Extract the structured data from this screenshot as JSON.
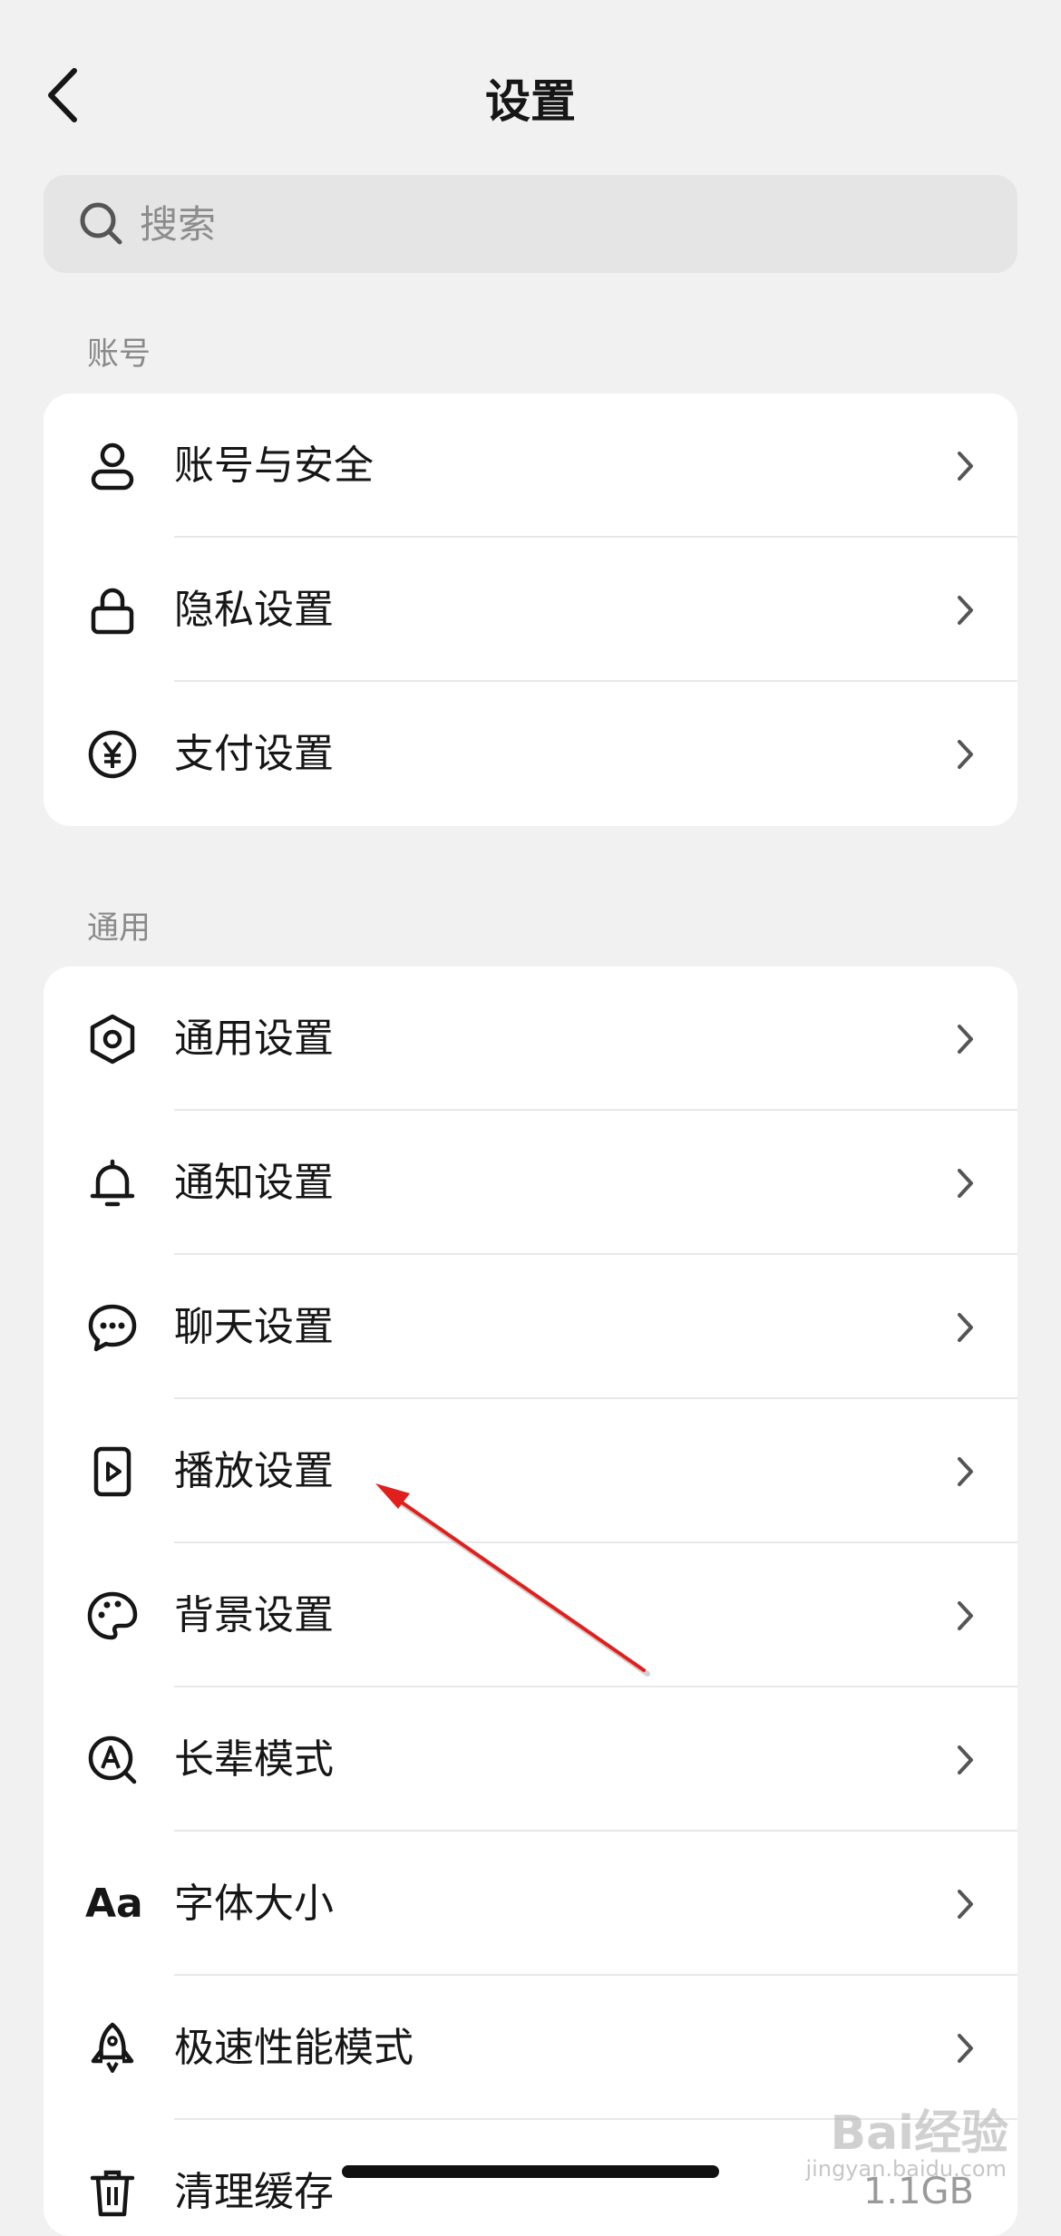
{
  "header": {
    "title": "设置"
  },
  "search": {
    "placeholder": "搜索"
  },
  "sections": [
    {
      "label": "账号",
      "items": [
        {
          "icon": "user-icon",
          "label": "账号与安全"
        },
        {
          "icon": "lock-icon",
          "label": "隐私设置"
        },
        {
          "icon": "yen-icon",
          "label": "支付设置"
        }
      ]
    },
    {
      "label": "通用",
      "items": [
        {
          "icon": "gear-icon",
          "label": "通用设置"
        },
        {
          "icon": "bell-icon",
          "label": "通知设置"
        },
        {
          "icon": "chat-bubble-icon",
          "label": "聊天设置"
        },
        {
          "icon": "play-file-icon",
          "label": "播放设置"
        },
        {
          "icon": "palette-icon",
          "label": "背景设置"
        },
        {
          "icon": "elder-mode-icon",
          "label": "长辈模式"
        },
        {
          "icon": "font-size-icon",
          "label": "字体大小",
          "icon_text": "Aa"
        },
        {
          "icon": "rocket-icon",
          "label": "极速性能模式"
        },
        {
          "icon": "trash-icon",
          "label": "清理缓存",
          "value": "1.1GB"
        }
      ]
    }
  ],
  "watermark": {
    "brand": "Bai经验",
    "url": "jingyan.baidu.com"
  },
  "colors": {
    "background": "#f1f1f1",
    "card": "#ffffff",
    "annotation_arrow": "#e0201c"
  }
}
